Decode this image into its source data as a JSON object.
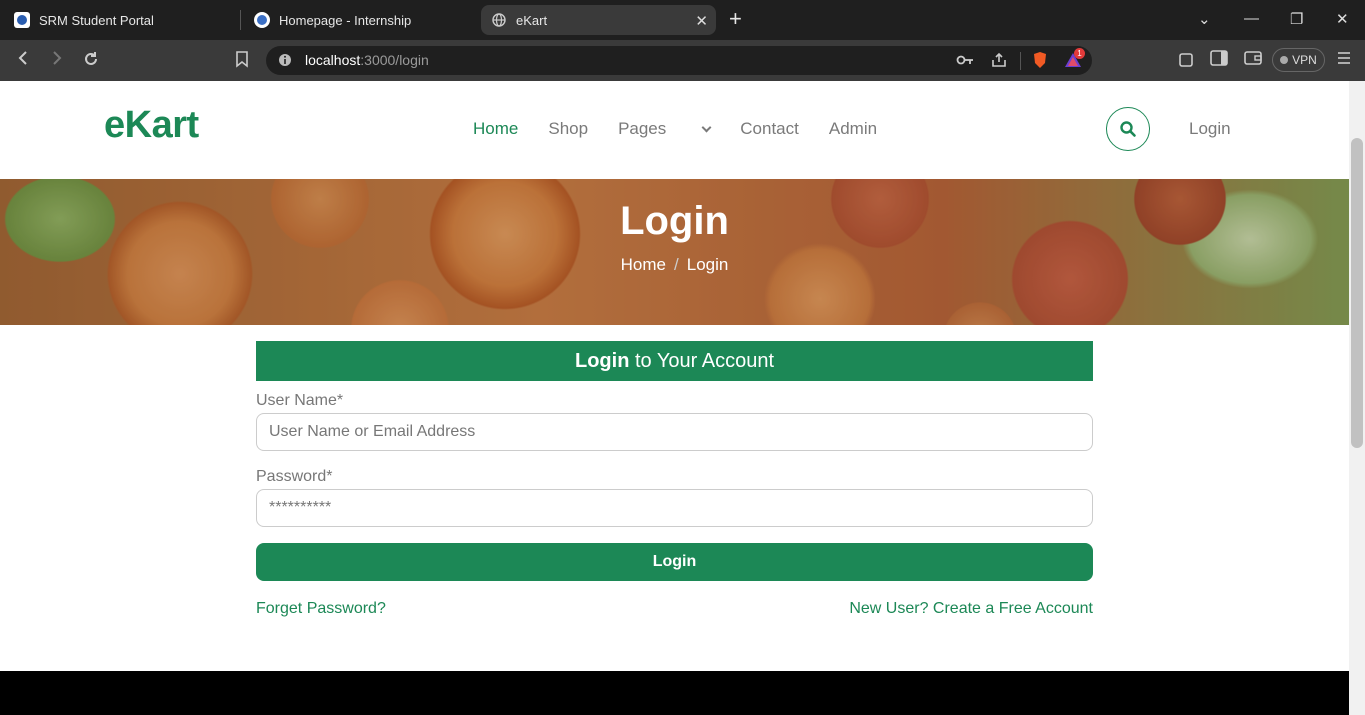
{
  "browser": {
    "tabs": [
      {
        "title": "SRM Student Portal",
        "icon": "srm-logo-icon"
      },
      {
        "title": "Homepage - Internship",
        "icon": "internship-logo-icon"
      },
      {
        "title": "eKart",
        "icon": "globe-icon"
      }
    ],
    "url_host": "localhost",
    "url_rest": ":3000/login",
    "vpn_label": "VPN",
    "notification_count": "1"
  },
  "nav": {
    "logo": "eKart",
    "items": [
      {
        "label": "Home",
        "active": true
      },
      {
        "label": "Shop"
      },
      {
        "label": "Pages"
      },
      {
        "label": "Contact"
      },
      {
        "label": "Admin"
      }
    ],
    "login": "Login"
  },
  "hero": {
    "title": "Login",
    "breadcrumb": [
      "Home",
      "/",
      "Login"
    ]
  },
  "form": {
    "heading_bold": "Login",
    "heading_rest": " to Your Account",
    "username_label": "User Name*",
    "username_placeholder": "User Name or Email Address",
    "password_label": "Password*",
    "password_value": "**********",
    "submit": "Login",
    "forgot": "Forget Password?",
    "signup": "New User? Create a Free Account"
  },
  "colors": {
    "brand": "#1c8856"
  }
}
